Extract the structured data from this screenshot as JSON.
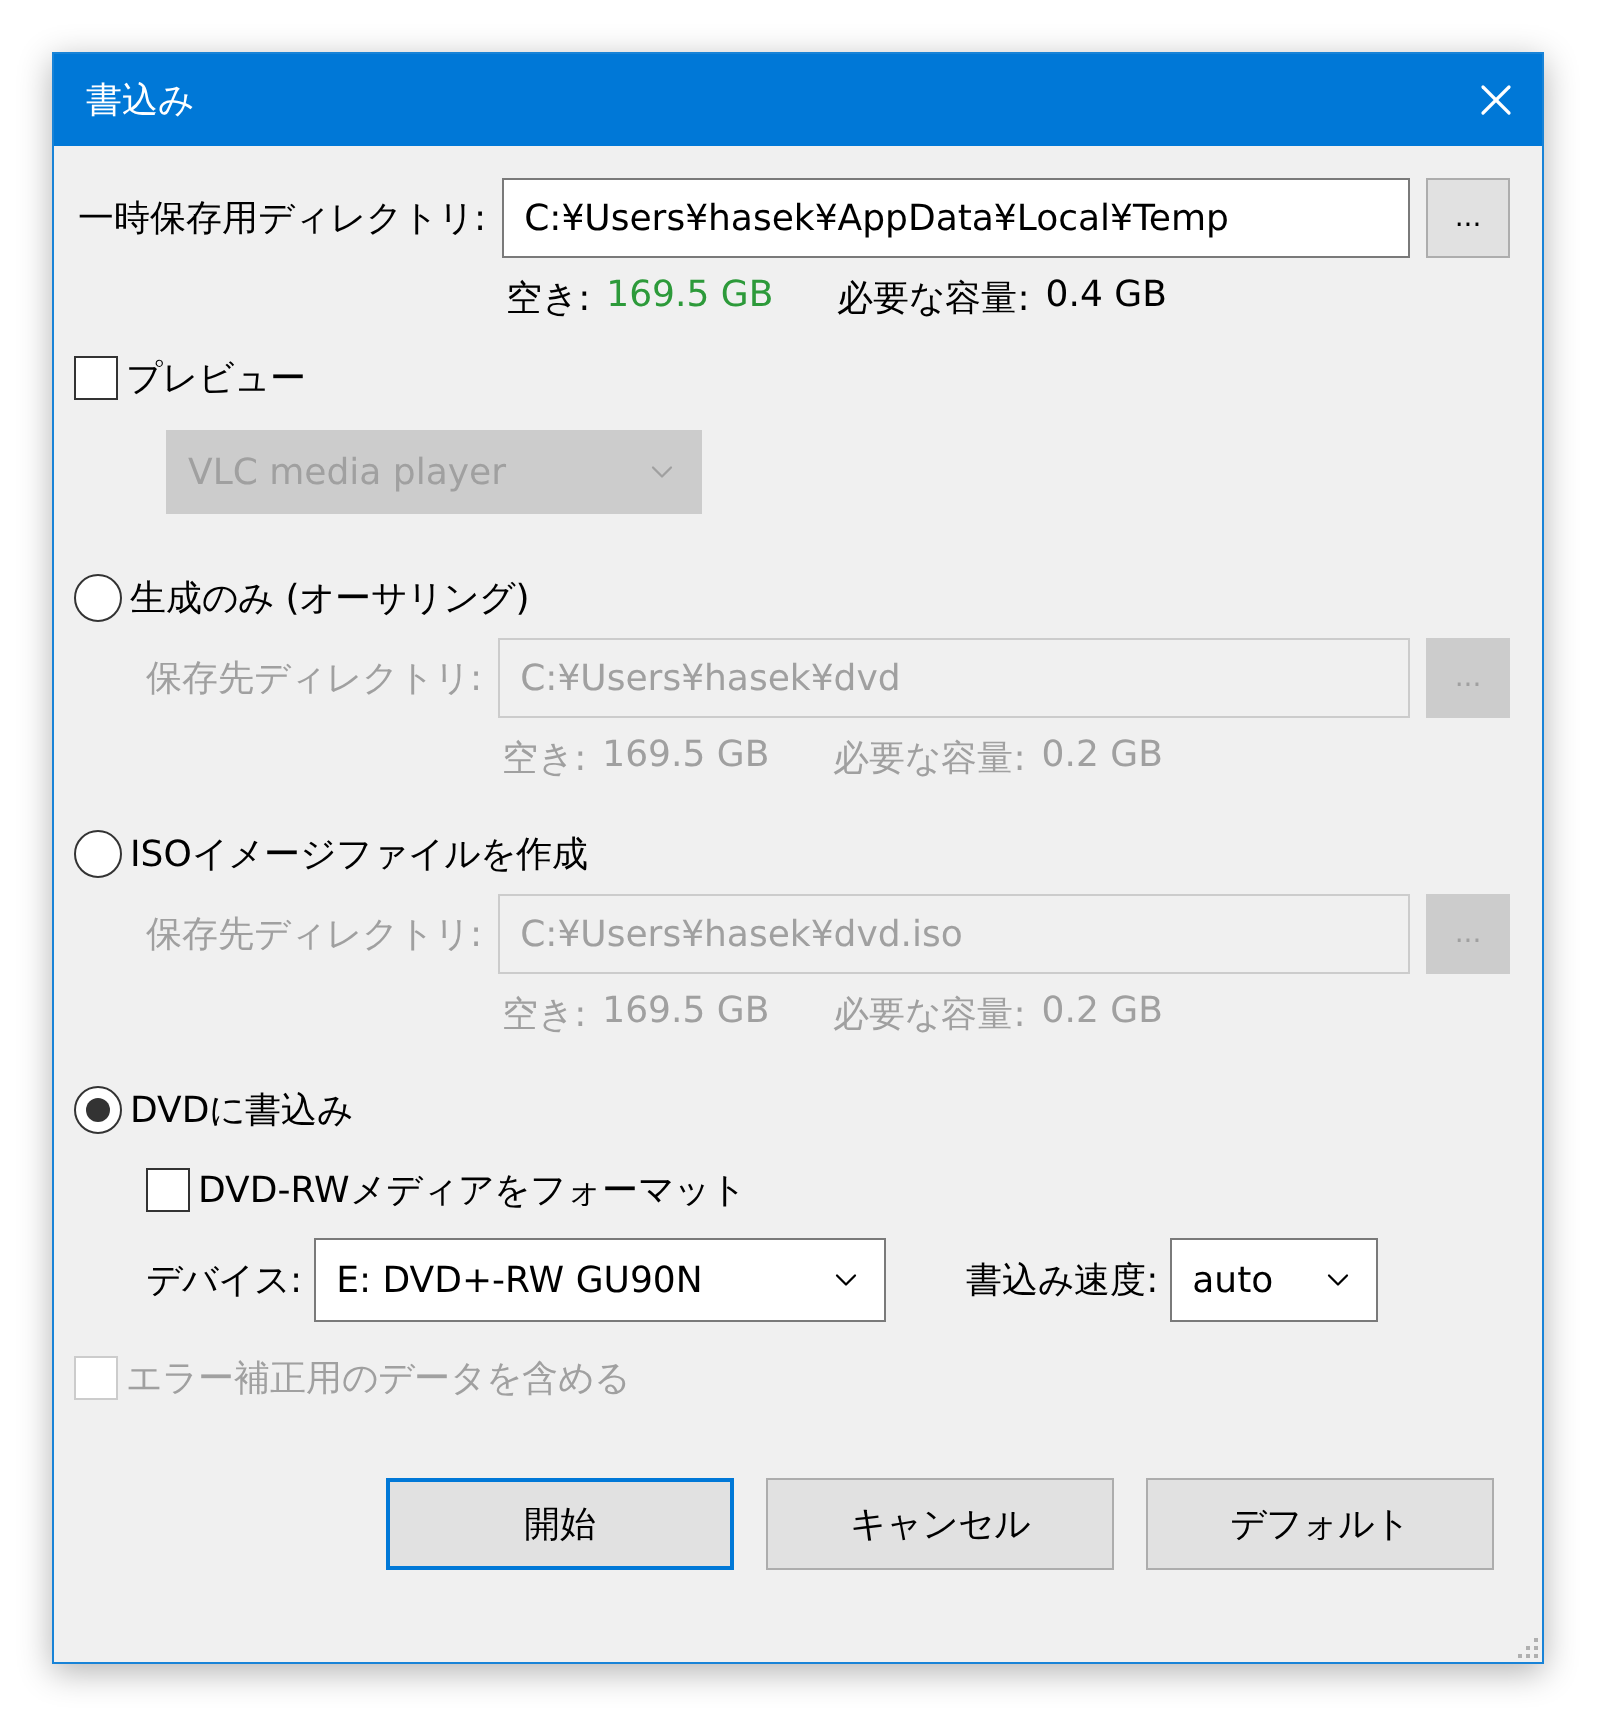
{
  "window": {
    "title": "書込み"
  },
  "temp_dir": {
    "label": "一時保存用ディレクトリ:",
    "value": "C:¥Users¥hasek¥AppData¥Local¥Temp",
    "browse": "...",
    "free_label": "空き:",
    "free": "169.5 GB",
    "required_label": "必要な容量:",
    "required": "0.4 GB",
    "disabled": false
  },
  "preview": {
    "label": "プレビュー",
    "checked": false,
    "player": {
      "value": "VLC media player",
      "disabled": true
    }
  },
  "modes": [
    {
      "kind": "directory",
      "label": "生成のみ (オーサリング)",
      "selected": false,
      "dir": {
        "label": "保存先ディレクトリ:",
        "value": "C:¥Users¥hasek¥dvd",
        "browse": "...",
        "free_label": "空き:",
        "free": "169.5 GB",
        "required_label": "必要な容量:",
        "required": "0.2 GB",
        "disabled": true
      }
    },
    {
      "kind": "directory",
      "label": "ISOイメージファイルを作成",
      "selected": false,
      "dir": {
        "label": "保存先ディレクトリ:",
        "value": "C:¥Users¥hasek¥dvd.iso",
        "browse": "...",
        "free_label": "空き:",
        "free": "169.5 GB",
        "required_label": "必要な容量:",
        "required": "0.2 GB",
        "disabled": true
      }
    },
    {
      "kind": "burn",
      "label": "DVDに書込み",
      "selected": true,
      "format": {
        "label": "DVD-RWメディアをフォーマット",
        "checked": false
      },
      "device": {
        "label": "デバイス:",
        "value": "E: DVD+-RW GU90N"
      },
      "speed": {
        "label": "書込み速度:",
        "value": "auto"
      }
    }
  ],
  "ecc": {
    "label": "エラー補正用のデータを含める",
    "checked": false,
    "disabled": true
  },
  "buttons": [
    {
      "label": "開始",
      "default": true
    },
    {
      "label": "キャンセル",
      "default": false
    },
    {
      "label": "デフォルト",
      "default": false
    }
  ]
}
